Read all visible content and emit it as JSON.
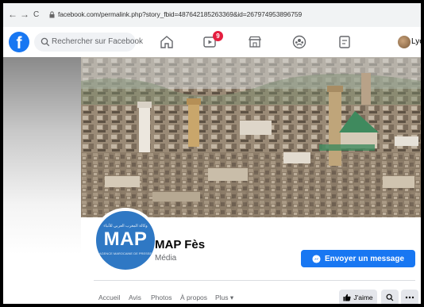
{
  "browser": {
    "back": "←",
    "forward": "→",
    "reload": "C",
    "url": "facebook.com/permalink.php?story_fbid=487642185263369&id=267974953896759"
  },
  "topbar": {
    "logo": "f",
    "search_placeholder": "Rechercher sur Facebook",
    "watch_badge": "9",
    "user_name": "Lyès",
    "icons": [
      "home-icon",
      "watch-icon",
      "marketplace-icon",
      "groups-icon",
      "gaming-icon"
    ]
  },
  "page": {
    "profile_logo_text": "MAP",
    "profile_logo_arabic": "وكالة المغرب العربي للأنباء",
    "profile_logo_sub": "AGENCE MAROCAINE DE PRESSE",
    "name": "MAP Fès",
    "category": "Média",
    "message_button": "Envoyer un message"
  },
  "tabs": [
    {
      "label": "Accueil"
    },
    {
      "label": "Avis"
    },
    {
      "label": "Photos"
    },
    {
      "label": "À propos"
    },
    {
      "label": "Plus ▾"
    }
  ],
  "actions": {
    "like_label": "J'aime"
  },
  "colors": {
    "brand": "#1877f2",
    "badge": "#e41e3f",
    "mosque_roof": "#3f8a5e"
  }
}
